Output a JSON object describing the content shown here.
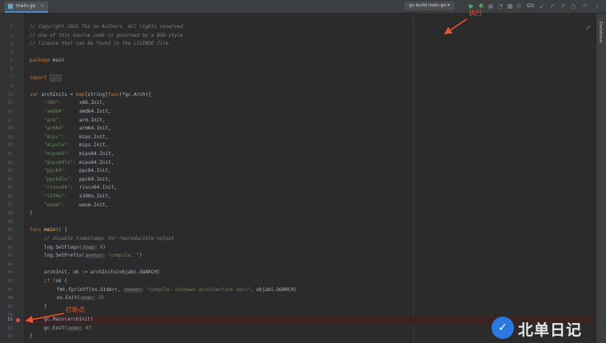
{
  "editor": {
    "tab_label": "main.go",
    "run_config": "go build main.go",
    "git_label": "Git:",
    "right_panel_label": "Database"
  },
  "annotations": {
    "run": "执行",
    "breakpoint": "打断点"
  },
  "watermark": {
    "text": "北单日记"
  },
  "code_lines": [
    {
      "num": "1"
    },
    {
      "num": "2"
    },
    {
      "num": "3"
    },
    {
      "num": "4"
    },
    {
      "num": "5"
    },
    {
      "num": "6"
    },
    {
      "num": "7"
    },
    {
      "num": "8"
    },
    {
      "num": "24"
    },
    {
      "num": "25"
    },
    {
      "num": "26"
    },
    {
      "num": "27"
    },
    {
      "num": "28"
    },
    {
      "num": "29"
    },
    {
      "num": "30"
    },
    {
      "num": "31"
    },
    {
      "num": "32"
    },
    {
      "num": "33"
    },
    {
      "num": "34"
    },
    {
      "num": "35"
    },
    {
      "num": "36"
    },
    {
      "num": "37"
    },
    {
      "num": "38"
    },
    {
      "num": "39"
    },
    {
      "num": "40"
    },
    {
      "num": "41"
    },
    {
      "num": "42"
    },
    {
      "num": "43"
    },
    {
      "num": "44"
    },
    {
      "num": "45"
    },
    {
      "num": "46"
    },
    {
      "num": "47"
    },
    {
      "num": "48"
    },
    {
      "num": "49"
    },
    {
      "num": "50"
    },
    {
      "num": "51"
    },
    {
      "num": "52"
    },
    {
      "num": "53"
    },
    {
      "num": "54"
    }
  ],
  "code": {
    "copyright": "// Copyright 2015 The Go Authors. All rights reserved.",
    "license1": "// Use of this source code is governed by a BSD-style",
    "license2": "// license that can be found in the LICENSE file.",
    "pkg_kw": "package",
    "pkg_name": " main",
    "import_kw": "import",
    "import_fold": "...",
    "var_kw": "var",
    "var_decl_1": " archInits = ",
    "var_decl_map": "map",
    "var_decl_2": "[string]",
    "var_decl_func": "func",
    "var_decl_3": "(*gc.Arch){",
    "arch_entries": [
      {
        "key": "\"386\":",
        "val": "x86.Init,"
      },
      {
        "key": "\"amd64\":",
        "val": "amd64.Init,"
      },
      {
        "key": "\"arm\":",
        "val": "arm.Init,"
      },
      {
        "key": "\"arm64\":",
        "val": "arm64.Init,"
      },
      {
        "key": "\"mips\":",
        "val": "mips.Init,"
      },
      {
        "key": "\"mipsle\":",
        "val": "mips.Init,"
      },
      {
        "key": "\"mips64\":",
        "val": "mips64.Init,"
      },
      {
        "key": "\"mips64le\":",
        "val": "mips64.Init,"
      },
      {
        "key": "\"ppc64\":",
        "val": "ppc64.Init,"
      },
      {
        "key": "\"ppc64le\":",
        "val": "ppc64.Init,"
      },
      {
        "key": "\"riscv64\":",
        "val": "riscv64.Init,"
      },
      {
        "key": "\"s390x\":",
        "val": "s390x.Init,"
      },
      {
        "key": "\"wasm\":",
        "val": "wasm.Init,"
      }
    ],
    "close_brace": "}",
    "func_kw": "func",
    "func_name": " main",
    "func_tail": "() {",
    "disable_comment": "// disable timestamps for reproducible output",
    "setflags": "log.SetFlags(",
    "setflags_hint": "flag:",
    "setflags_arg": " 0",
    "setflags_close": ")",
    "setprefix": "log.SetPrefix(",
    "setprefix_hint": "prefix:",
    "setprefix_arg": " \"compile: \"",
    "setprefix_close": ")",
    "archinit_line": "archInit, ok := archInits[objabi.GOARCH]",
    "if_kw": "if",
    "if_rest": " !ok {",
    "fprintf_1": "fmt.Fprintf(os.Stderr,",
    "fprintf_hint": "format:",
    "fprintf_str": " \"compile: unknown architecture %q\\n\"",
    "fprintf_2": ", objabi.GOARCH)",
    "exit_call": "os.Exit(",
    "exit_hint": "code:",
    "exit_arg": " 2",
    "exit_close": ")",
    "inner_close": "}",
    "gcmain": "gc.Main(archInit)",
    "gcexit": "gc.Exit(",
    "gcexit_hint": "code:",
    "gcexit_arg": " 0",
    "gcexit_close": ")",
    "final_close": "}"
  },
  "colors": {
    "annotation": "#e8542f",
    "breakpoint": "#c75450",
    "keyword": "#cc7832",
    "string": "#6a8759",
    "comment": "#808080",
    "number": "#6897bb",
    "logo_blue": "#2b79e0"
  }
}
